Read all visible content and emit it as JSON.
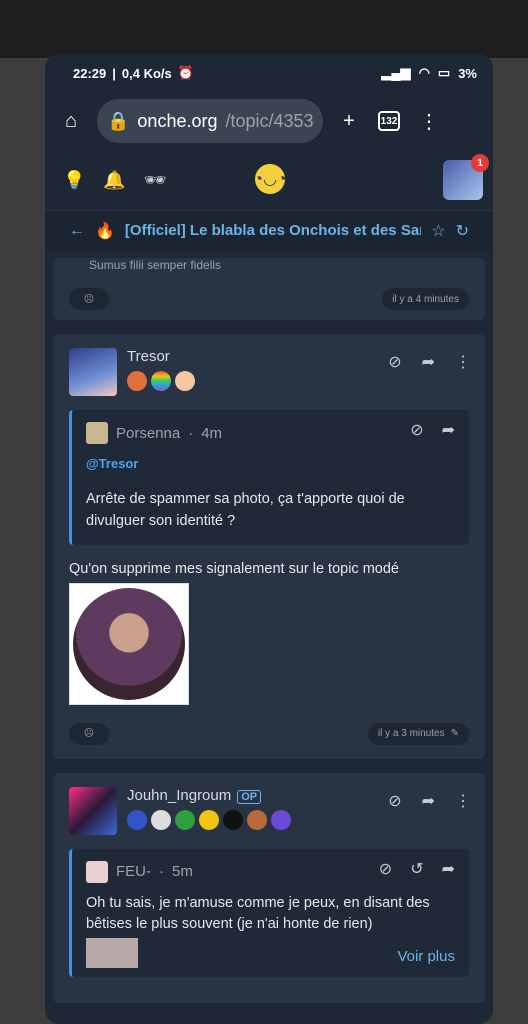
{
  "status": {
    "time": "22:29",
    "speed": "0,4 Ko/s",
    "battery": "3%"
  },
  "browser": {
    "url_host": "onche.org",
    "url_path": "/topic/4353",
    "tab_count": "132"
  },
  "site": {
    "notif_count": "1"
  },
  "topic": {
    "title": "[Officiel] Le blabla des Onchois et des Sar"
  },
  "clipped_post": {
    "text": "Sumus filii     semper fidelis",
    "time": "il y a 4 minutes"
  },
  "post1": {
    "user": "Tresor",
    "quote": {
      "user": "Porsenna",
      "time": "4m",
      "mention": "@Tresor",
      "text": "Arrête de spammer sa photo, ça t'apporte quoi de divulguer son identité ?"
    },
    "text": "Qu'on supprime mes signalement sur le topic modé",
    "time": "il y a 3 minutes"
  },
  "post2": {
    "user": "Jouhn_Ingroum",
    "op": "OP",
    "quote": {
      "user": "FEU-",
      "time": "5m",
      "text": "Oh tu sais, je m'amuse comme je peux, en disant des bêtises le plus souvent (je n'ai honte de rien)"
    },
    "more": "Voir plus"
  }
}
